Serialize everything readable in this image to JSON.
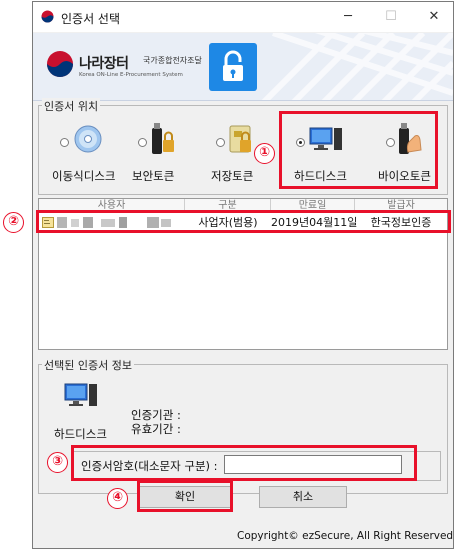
{
  "window": {
    "title": "인증서 선택",
    "controls": {
      "minimize": "─",
      "maximize": "☐",
      "close": "✕"
    }
  },
  "banner": {
    "logo_text": "나라장터",
    "logo_sub": "국가종합전자조달",
    "logo_eng": "Korea ON-Line E-Procurement System"
  },
  "location": {
    "label": "인증서 위치",
    "options": [
      {
        "label": "이동식디스크",
        "selected": false,
        "icon": "disc-icon"
      },
      {
        "label": "보안토큰",
        "selected": false,
        "icon": "security-token-icon"
      },
      {
        "label": "저장토큰",
        "selected": false,
        "icon": "storage-token-icon"
      },
      {
        "label": "하드디스크",
        "selected": true,
        "icon": "computer-icon"
      },
      {
        "label": "바이오토큰",
        "selected": false,
        "icon": "bio-token-icon"
      }
    ]
  },
  "table": {
    "columns": [
      "사용자",
      "구분",
      "만료일",
      "발급자"
    ],
    "rows": [
      {
        "user": "",
        "type": "사업자(범용)",
        "expiry": "2019년04월11일",
        "issuer": "한국정보인증"
      }
    ]
  },
  "selected_info": {
    "label": "선택된 인증서 정보",
    "device_label": "하드디스크",
    "issuer_label": "인증기관 :",
    "validity_label": "유효기간 :"
  },
  "password": {
    "label": "인증서암호(대소문자 구분) :",
    "value": ""
  },
  "buttons": {
    "confirm": "확인",
    "cancel": "취소"
  },
  "copyright": "Copyright© ezSecure, All Right Reserved",
  "annotations": {
    "n1": "①",
    "n2": "②",
    "n3": "③",
    "n4": "④"
  },
  "colors": {
    "highlight": "#e8102a",
    "accent": "#1e88e5"
  }
}
